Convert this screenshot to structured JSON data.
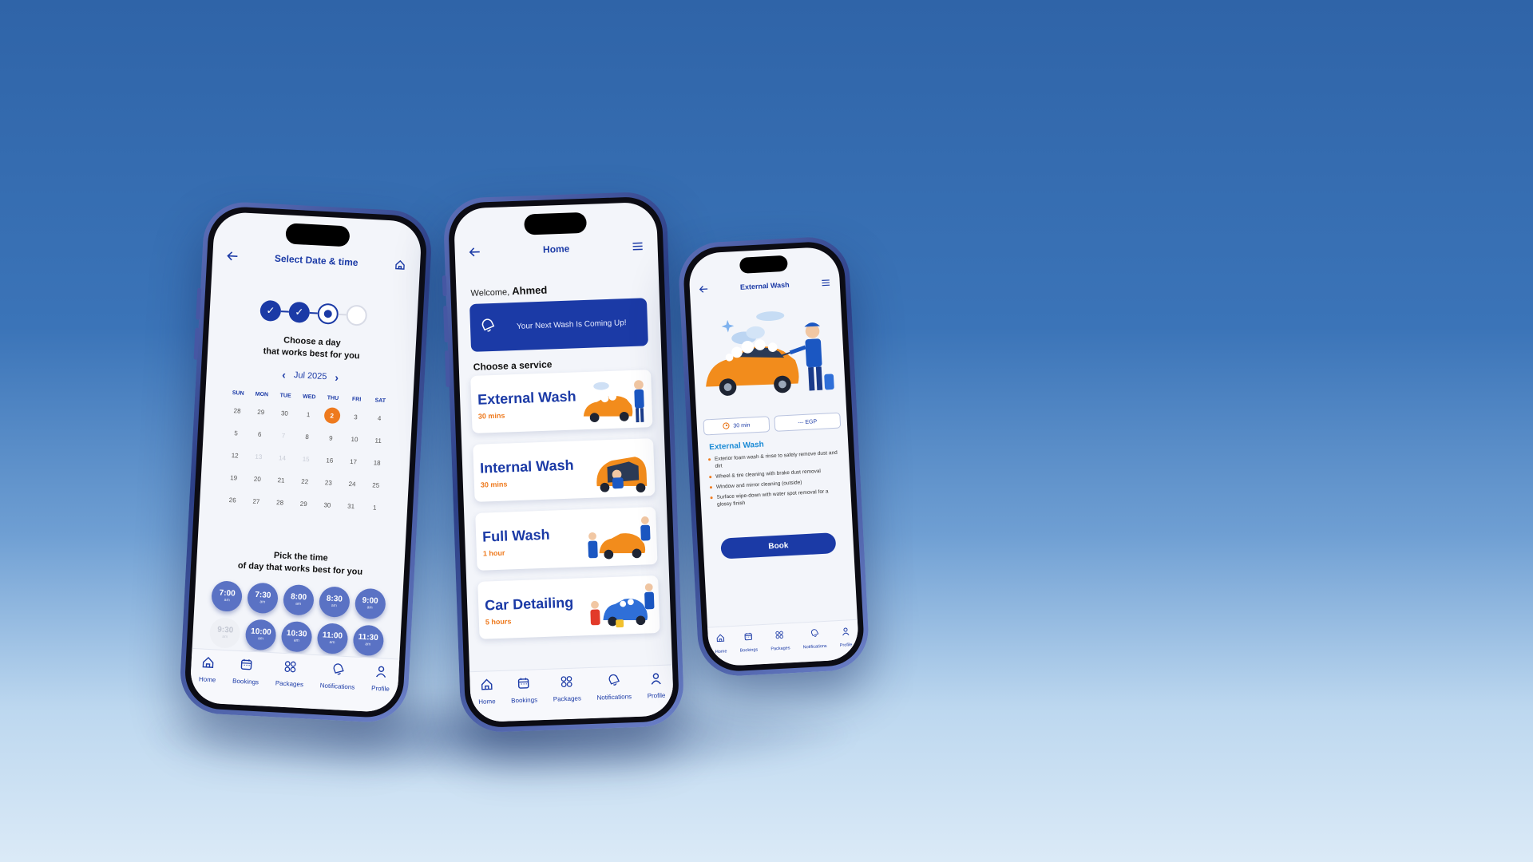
{
  "colors": {
    "primary": "#1b3aa6",
    "accent": "#ee7a1e",
    "time_bubble": "#5a72c4"
  },
  "nav": {
    "items": [
      {
        "label": "Home",
        "icon": "home-icon"
      },
      {
        "label": "Bookings",
        "icon": "calendar-icon"
      },
      {
        "label": "Packages",
        "icon": "grid-icon"
      },
      {
        "label": "Notifications",
        "icon": "bell-icon"
      },
      {
        "label": "Profile",
        "icon": "user-icon"
      }
    ]
  },
  "date_screen": {
    "title": "Select Date & time",
    "steps": [
      "done",
      "done",
      "current",
      "todo"
    ],
    "heading_line1": "Choose a day",
    "heading_line2": "that works best for you",
    "month": "Jul 2025",
    "days_of_week": [
      "SUN",
      "MON",
      "TUE",
      "WED",
      "THU",
      "FRI",
      "SAT"
    ],
    "weeks": [
      [
        "28",
        "29",
        "30",
        "1",
        "2",
        "3",
        "4"
      ],
      [
        "5",
        "6",
        "7",
        "8",
        "9",
        "10",
        "11"
      ],
      [
        "12",
        "13",
        "14",
        "15",
        "16",
        "17",
        "18"
      ],
      [
        "19",
        "20",
        "21",
        "22",
        "23",
        "24",
        "25"
      ],
      [
        "26",
        "27",
        "28",
        "29",
        "30",
        "31",
        "1"
      ]
    ],
    "selected_day": "2",
    "time_heading_line1": "Pick the time",
    "time_heading_line2": "of day that works best for you",
    "times": [
      {
        "time": "7:00",
        "ampm": "am"
      },
      {
        "time": "7:30",
        "ampm": "am"
      },
      {
        "time": "8:00",
        "ampm": "am"
      },
      {
        "time": "8:30",
        "ampm": "am"
      },
      {
        "time": "9:00",
        "ampm": "am"
      },
      {
        "time": "9:30",
        "ampm": "am"
      },
      {
        "time": "10:00",
        "ampm": "am"
      },
      {
        "time": "10:30",
        "ampm": "am"
      },
      {
        "time": "11:00",
        "ampm": "am"
      },
      {
        "time": "11:30",
        "ampm": "am"
      }
    ]
  },
  "home_screen": {
    "title": "Home",
    "welcome_prefix": "Welcome,",
    "user_name": "Ahmed",
    "banner_text": "Your Next Wash Is Coming Up!",
    "section_title": "Choose a service",
    "services": [
      {
        "name": "External Wash",
        "duration": "30 mins"
      },
      {
        "name": "Internal Wash",
        "duration": "30 mins"
      },
      {
        "name": "Full Wash",
        "duration": "1 hour"
      },
      {
        "name": "Car Detailing",
        "duration": "5 hours"
      }
    ]
  },
  "detail_screen": {
    "title": "External Wash",
    "duration_chip": "30 min",
    "price_chip": "--- EGP",
    "section_title": "External Wash",
    "bullets": [
      "Exterior foam wash & rinse to safely remove dust and dirt",
      "Wheel & tire cleaning with brake dust removal",
      "Window and mirror cleaning (outside)",
      "Surface wipe-down with water spot removal for a glossy finish"
    ],
    "book_label": "Book"
  }
}
